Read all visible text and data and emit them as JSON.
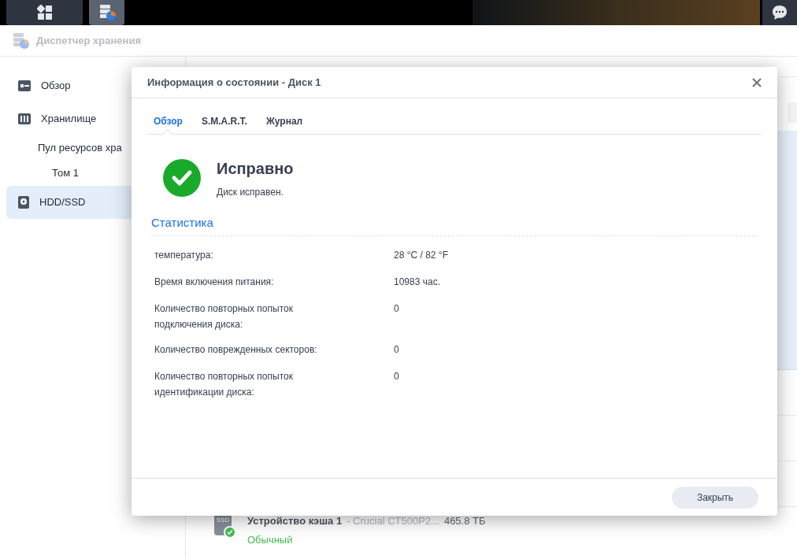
{
  "app": {
    "title": "Диспетчер хранения"
  },
  "sidebar": {
    "items": [
      {
        "label": "Обзор",
        "kind": "overview",
        "selected": false
      },
      {
        "label": "Хранилище",
        "kind": "storage",
        "selected": false,
        "children": [
          {
            "label": "Пул ресурсов хра",
            "children": [
              {
                "label": "Том 1"
              }
            ]
          }
        ]
      },
      {
        "label": "HDD/SSD",
        "kind": "disk",
        "selected": true
      }
    ]
  },
  "background_row": {
    "name": "Устройство кэша 1",
    "model": "- Crucial CT500P2...",
    "size": "465.8 ТБ",
    "status": "Обычный",
    "badge": "SSD"
  },
  "dialog": {
    "title": "Информация о состоянии - Диск 1",
    "tabs": [
      {
        "label": "Обзор",
        "selected": true
      },
      {
        "label": "S.M.A.R.T.",
        "selected": false
      },
      {
        "label": "Журнал",
        "selected": false
      }
    ],
    "status": {
      "title": "Исправно",
      "description": "Диск исправен."
    },
    "section_title": "Статистика",
    "stats": [
      {
        "label": "температура:",
        "value": "28 °C / 82 °F"
      },
      {
        "label": "Время включения питания:",
        "value": "10983 час."
      },
      {
        "label": "Количество повторных попыток подключения диска:",
        "value": "0"
      },
      {
        "label": "Количество поврежденных секторов:",
        "value": "0"
      },
      {
        "label": "Количество повторных попыток идентификации диска:",
        "value": "0"
      }
    ],
    "close_button": "Закрыть"
  }
}
